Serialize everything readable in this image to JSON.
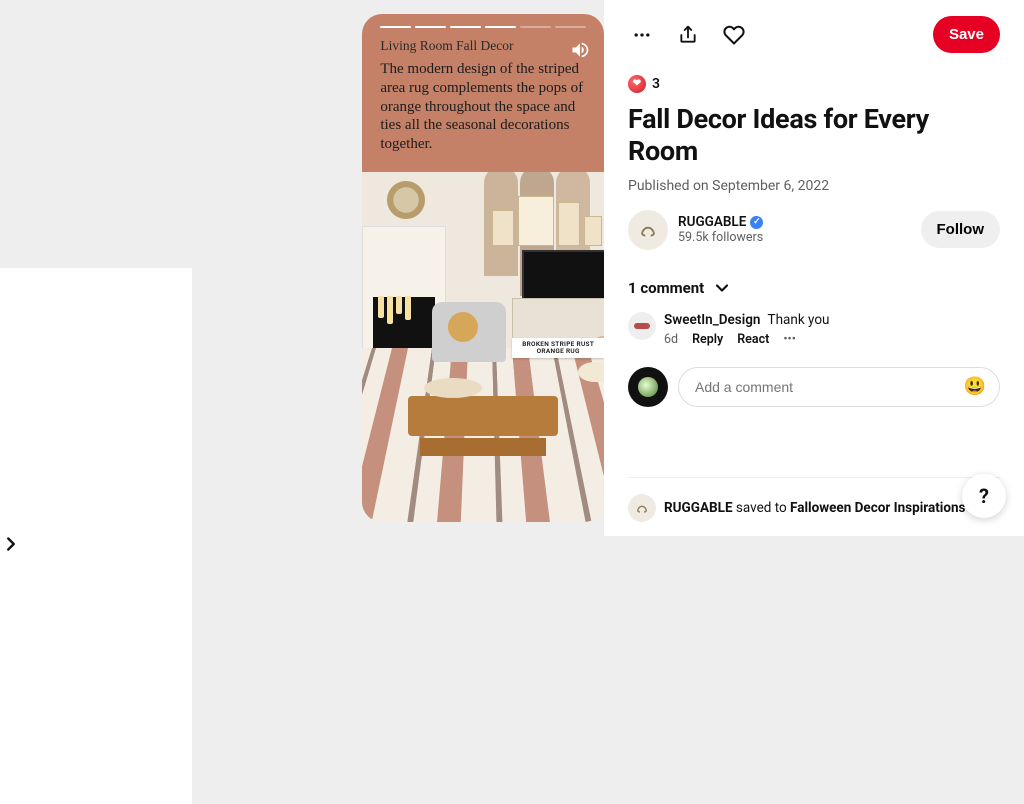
{
  "story": {
    "subtitle": "Living Room Fall Decor",
    "body": "The modern design of the striped area rug complements the pops of orange throughout the space and ties all the seasonal decorations together.",
    "product_tag": "BROKEN STRIPE RUST ORANGE RUG",
    "segments_total": 6,
    "segments_active": 4
  },
  "pin": {
    "reaction_count": "3",
    "title": "Fall Decor Ideas for Every Room",
    "published": "Published on September 6, 2022",
    "save_label": "Save"
  },
  "author": {
    "name": "RUGGABLE",
    "followers": "59.5k followers",
    "follow_label": "Follow"
  },
  "comments": {
    "header": "1 comment",
    "items": [
      {
        "name": "SweetIn_Design",
        "text": "Thank you",
        "age": "6d",
        "reply_label": "Reply",
        "react_label": "React"
      }
    ],
    "add_placeholder": "Add a comment"
  },
  "saved": {
    "user": "RUGGABLE",
    "verb": "saved to",
    "board": "Falloween Decor Inspirations"
  },
  "help_label": "?"
}
